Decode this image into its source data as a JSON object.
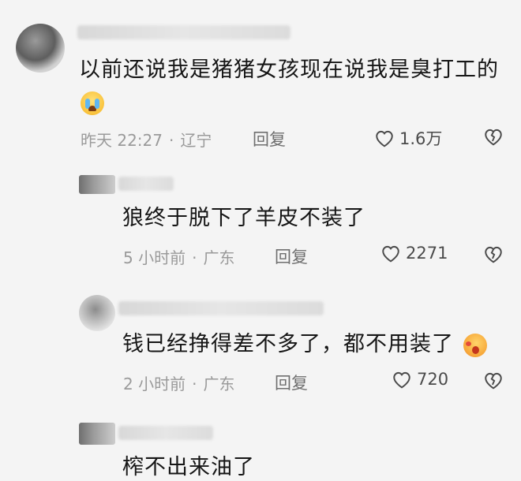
{
  "comments": [
    {
      "text": "以前还说我是猪猪女孩现在说我是臭打工的",
      "emoji": "loudly-crying-face",
      "time": "昨天 22:27",
      "location": "辽宁",
      "reply_label": "回复",
      "likes": "1.6万"
    },
    {
      "text": "狼终于脱下了羊皮不装了",
      "time": "5 小时前",
      "location": "广东",
      "reply_label": "回复",
      "likes": "2271"
    },
    {
      "text": "钱已经挣得差不多了，都不用装了",
      "emoji": "shocked-face",
      "time": "2 小时前",
      "location": "广东",
      "reply_label": "回复",
      "likes": "720"
    },
    {
      "text": "榨不出来油了"
    }
  ],
  "separator": "·",
  "icons": {
    "like": "heart-outline-icon",
    "dislike": "broken-heart-icon"
  },
  "colors": {
    "background": "#f4f4f4",
    "meta": "#9a9a9a",
    "text": "#161616"
  }
}
